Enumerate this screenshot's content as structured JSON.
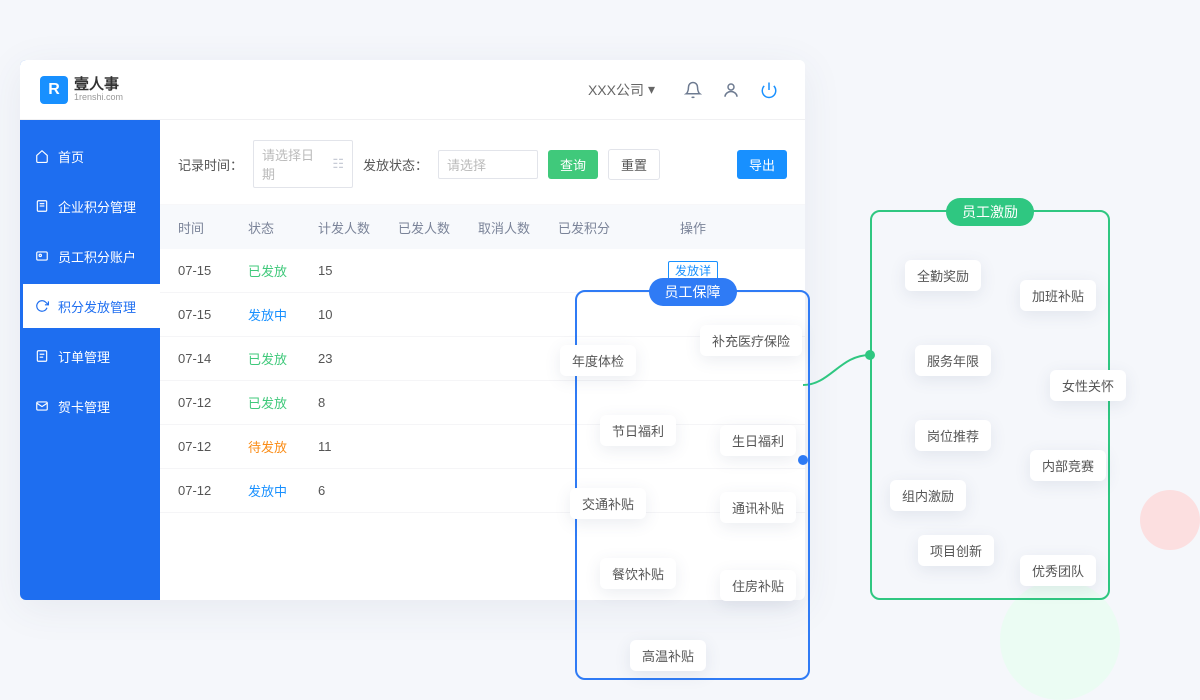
{
  "header": {
    "brand_name": "壹人事",
    "brand_sub": "1renshi.com",
    "company": "XXX公司"
  },
  "sidebar": {
    "items": [
      {
        "icon": "home",
        "label": "首页"
      },
      {
        "icon": "enterprise",
        "label": "企业积分管理"
      },
      {
        "icon": "employee",
        "label": "员工积分账户"
      },
      {
        "icon": "distribute",
        "label": "积分发放管理"
      },
      {
        "icon": "order",
        "label": "订单管理"
      },
      {
        "icon": "card",
        "label": "贺卡管理"
      }
    ],
    "active_index": 3
  },
  "filters": {
    "time_label": "记录时间：",
    "date_placeholder": "请选择日期",
    "status_label": "发放状态：",
    "status_placeholder": "请选择",
    "search_btn": "查询",
    "reset_btn": "重置",
    "export_btn": "导出"
  },
  "table": {
    "columns": [
      "时间",
      "状态",
      "计发人数",
      "已发人数",
      "取消人数",
      "已发积分",
      "操作"
    ],
    "op_label": "发放详",
    "rows": [
      {
        "date": "07-15",
        "status": "已发放",
        "status_cls": "done",
        "plan": "15",
        "op": true
      },
      {
        "date": "07-15",
        "status": "发放中",
        "status_cls": "progress",
        "plan": "10"
      },
      {
        "date": "07-14",
        "status": "已发放",
        "status_cls": "done",
        "plan": "23"
      },
      {
        "date": "07-12",
        "status": "已发放",
        "status_cls": "done",
        "plan": "8"
      },
      {
        "date": "07-12",
        "status": "待发放",
        "status_cls": "pending",
        "plan": "11"
      },
      {
        "date": "07-12",
        "status": "发放中",
        "status_cls": "progress",
        "plan": "6"
      }
    ]
  },
  "mindmap": {
    "box1": {
      "title": "员工保障",
      "color": "#2f7bf5",
      "tags_left": [
        "年度体检",
        "节日福利",
        "交通补贴",
        "餐饮补贴",
        "高温补贴"
      ],
      "tags_right": [
        "补充医疗保险",
        "生日福利",
        "通讯补贴",
        "住房补贴"
      ]
    },
    "box2": {
      "title": "员工激励",
      "color": "#2fc781",
      "tags_left": [
        "全勤奖励",
        "服务年限",
        "岗位推荐",
        "组内激励",
        "项目创新"
      ],
      "tags_right": [
        "加班补贴",
        "女性关怀",
        "内部竞赛",
        "优秀团队"
      ]
    }
  }
}
